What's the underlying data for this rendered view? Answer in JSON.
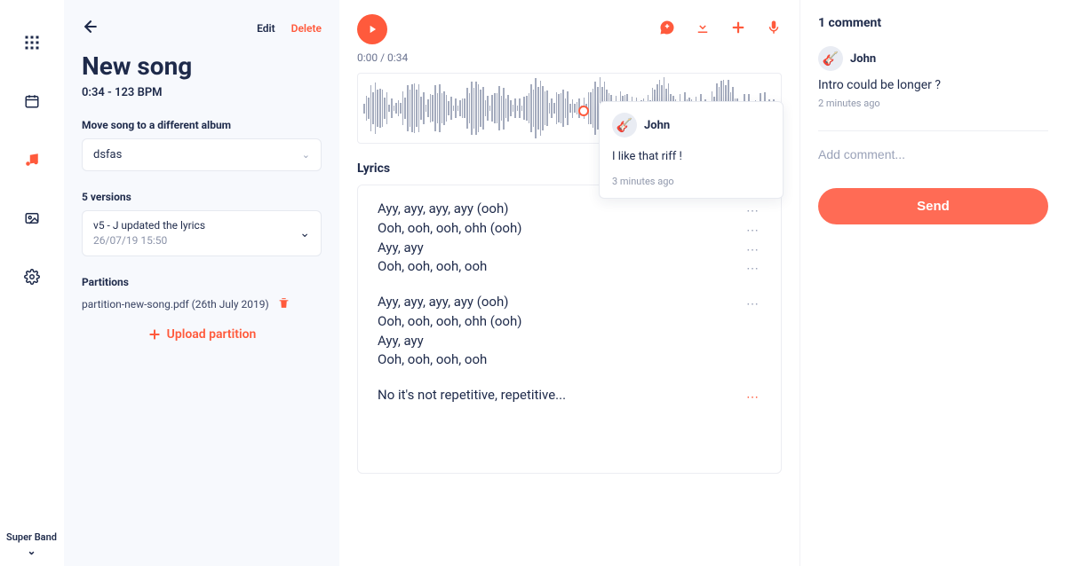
{
  "rail": {
    "band_name": "Super Band"
  },
  "panel": {
    "edit_label": "Edit",
    "delete_label": "Delete",
    "title": "New song",
    "duration_bpm": "0:34 - 123 BPM",
    "move_album_label": "Move song to a different album",
    "album_selected": "dsfas",
    "versions_label": "5 versions",
    "version_selected_title": "v5 - J updated the lyrics",
    "version_selected_date": "26/07/19 15:50",
    "partitions_label": "Partitions",
    "partition_file": "partition-new-song.pdf (26th July 2019)",
    "upload_label": "Upload partition"
  },
  "center": {
    "time": "0:00 / 0:34",
    "lyrics_heading": "Lyrics",
    "stanzas": [
      [
        "Ayy, ayy, ayy, ayy (ooh)",
        "Ooh, ooh, ooh, ohh (ooh)",
        "Ayy, ayy",
        "Ooh, ooh, ooh, ooh"
      ],
      [
        "Ayy, ayy, ayy, ayy (ooh)",
        "Ooh, ooh, ooh, ohh (ooh)",
        "Ayy, ayy",
        "Ooh, ooh, ooh, ooh"
      ],
      [
        "No it's not repetitive, repetitive..."
      ]
    ],
    "popover": {
      "author": "John",
      "body": "I like that riff !",
      "time": "3 minutes ago"
    }
  },
  "comments": {
    "heading": "1 comment",
    "items": [
      {
        "author": "John",
        "text": "Intro could be longer ?",
        "time": "2 minutes ago"
      }
    ],
    "add_placeholder": "Add comment...",
    "send_label": "Send"
  }
}
